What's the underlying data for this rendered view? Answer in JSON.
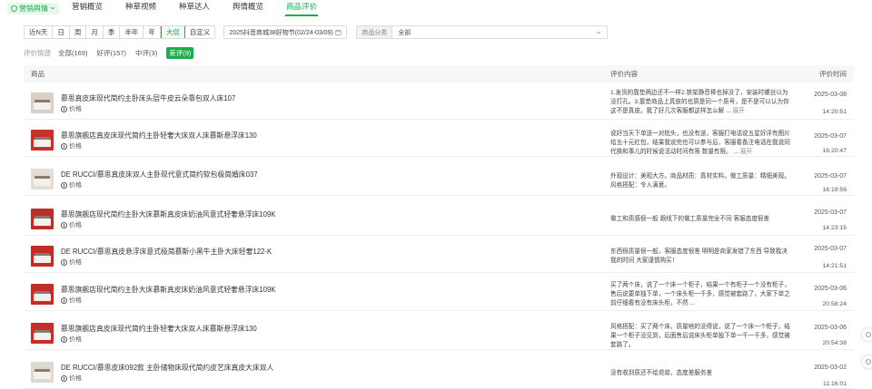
{
  "topnav": {
    "dropdown": "营销舆情",
    "items": [
      {
        "label": "营销概览",
        "active": false
      },
      {
        "label": "种草视频",
        "active": false
      },
      {
        "label": "种草达人",
        "active": false
      },
      {
        "label": "舆情概览",
        "active": false
      },
      {
        "label": "商品评价",
        "active": true
      }
    ]
  },
  "filters": {
    "periods": [
      {
        "label": "近N天",
        "active": false
      },
      {
        "label": "日",
        "active": false
      },
      {
        "label": "周",
        "active": false
      },
      {
        "label": "月",
        "active": false
      },
      {
        "label": "季",
        "active": false
      },
      {
        "label": "半年",
        "active": false
      },
      {
        "label": "年",
        "active": false
      },
      {
        "label": "大促",
        "active": true
      },
      {
        "label": "自定义",
        "active": false
      }
    ],
    "date_range": "2025抖音商城38好物节(02/24-03/09)",
    "category_label": "商品分类",
    "category_value": "全部"
  },
  "sentiment": {
    "label": "评价情感",
    "options": [
      {
        "label": "全部(169)",
        "active": false
      },
      {
        "label": "好评(157)",
        "active": false
      },
      {
        "label": "中评(3)",
        "active": false
      },
      {
        "label": "差评(9)",
        "active": true
      }
    ]
  },
  "table": {
    "columns": {
      "product": "商品",
      "review": "评价内容",
      "time": "评价时间"
    },
    "price_label": "价格",
    "rows": [
      {
        "name": "慕思真皮床现代简约主卧床头层牛皮云朵靠包双人床107",
        "review": "1.发货的靠垫两边还不一样2.铁架静音棒也掉没了，安装时螺丝以为没打孔。3.靠垫商品上真皮的也质是同一个质号，是不是可以认为你这不是真皮。我了好几次客服都这样怎么解 ...",
        "more": "展开",
        "date": "2025-03-08",
        "time": "14:20:51"
      },
      {
        "name": "慕思旗舰店真皮床现代简约主卧轻奢大床双人床慕斯悬浮床130",
        "review": "说好当天下单送一对枕头，也没有送，客服打电话说五星好评有图片给五十元红包，结果我说完也可以参与后，客服看备注电话在我说同代换和事儿的时候说活动时间有限 数量有限。 ...",
        "more": "展开",
        "date": "2025-03-07",
        "time": "16:20:47"
      },
      {
        "name": "DE RUCCI/慕思真皮床双人主卧现代意式简约软包极简婚床037",
        "review": "外观设计：美观大方。商品材质：真材实料。做工质量：精细美观。风格搭配：令人满意。",
        "more": "",
        "date": "2025-03-07",
        "time": "16:19:56"
      },
      {
        "name": "慕思旗舰店现代简约主卧大床慕斯真皮床奶油风意式轻奢悬浮床109K",
        "review": "做工和质感很一般 跟线下的做工质量完全不同 客服态度很差",
        "more": "",
        "date": "2025-03-07",
        "time": "14:23:15"
      },
      {
        "name": "DE RUCCI/慕思真皮悬浮床意式极简慕斯小黑牛主卧大床轻奢122-K",
        "review": "东西很质量很一般，客服态度很差 明明是商家发错了东西 导致我决我的时间 大家谨慎购买！",
        "more": "",
        "date": "2025-03-07",
        "time": "14:21:51"
      },
      {
        "name": "慕思旗舰店现代简约主卧大床慕斯真皮床奶油风意式轻奢悬浮床109K",
        "review": "买了两个床，说了一个床一个柜子，结果一个有柜子一个没有柜子，售后说要单独下单，一个床头柜一千多，感觉被套路了，大家下单之前仔细看有没有床头柜，不然 ...",
        "more": "",
        "date": "2025-03-06",
        "time": "20:58:24"
      },
      {
        "name": "慕思旗舰店真皮床现代简约主卧轻奢大床双人床慕斯悬浮床130",
        "review": "风格搭配：买了两个床，质量啥的没得说，说了一个床一个柜子，结果一个柜子没见到，后面售后说床头柜单独下单一千一千多，感觉被套路了。",
        "more": "",
        "date": "2025-03-06",
        "time": "20:54:38"
      },
      {
        "name": "DE RUCCI/慕思皮床092款 主卧储物床现代简约皮艺床真皮大床双人",
        "review": "没有收到质还不给退款，态度差服务差",
        "more": "",
        "date": "2025-03-02",
        "time": "11:16:01"
      }
    ]
  },
  "colors": {
    "accent": "#1aad4b"
  },
  "icons": {
    "dropdown": "shield-check-icon",
    "calendar": "calendar-icon",
    "chevron": "chevron-down-icon",
    "price": "info-circle-icon"
  }
}
